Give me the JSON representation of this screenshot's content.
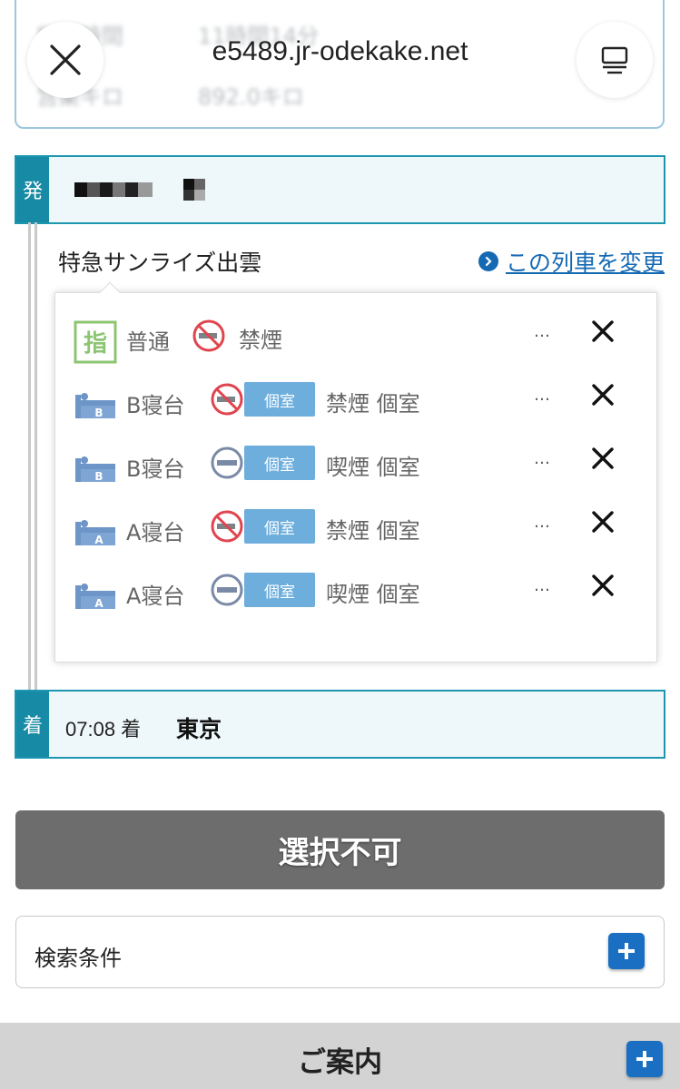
{
  "browser": {
    "url": "e5489.jr-odekake.net",
    "close_icon": "close-icon",
    "menu_icon": "tabs-icon"
  },
  "background_card": {
    "line1_label": "所要時間",
    "line1_value": "11時間14分",
    "line2_label": "営業キロ",
    "line2_value": "892.0キロ"
  },
  "departure": {
    "tag": "発"
  },
  "train": {
    "name": "特急サンライズ出雲",
    "change_link": "この列車を変更"
  },
  "seats": [
    {
      "icon": "reserved-seat-icon",
      "class": "普通",
      "smoking_icon": "no-smoking-icon",
      "private": "",
      "desc": "禁煙",
      "availability": "…",
      "status_icon": "unavailable-x-icon"
    },
    {
      "icon": "b-sleeper-icon",
      "class": "B寝台",
      "smoking_icon": "no-smoking-icon",
      "private": "個室",
      "desc": "禁煙 個室",
      "availability": "…",
      "status_icon": "unavailable-x-icon"
    },
    {
      "icon": "b-sleeper-icon",
      "class": "B寝台",
      "smoking_icon": "smoking-icon",
      "private": "個室",
      "desc": "喫煙 個室",
      "availability": "…",
      "status_icon": "unavailable-x-icon"
    },
    {
      "icon": "a-sleeper-icon",
      "class": "A寝台",
      "smoking_icon": "no-smoking-icon",
      "private": "個室",
      "desc": "禁煙 個室",
      "availability": "…",
      "status_icon": "unavailable-x-icon"
    },
    {
      "icon": "a-sleeper-icon",
      "class": "A寝台",
      "smoking_icon": "smoking-icon",
      "private": "個室",
      "desc": "喫煙 個室",
      "availability": "…",
      "status_icon": "unavailable-x-icon"
    }
  ],
  "arrival": {
    "tag": "着",
    "time": "07:08 着",
    "station": "東京"
  },
  "actions": {
    "select_button": "選択不可"
  },
  "search": {
    "label": "検索条件"
  },
  "guide": {
    "label": "ご案内"
  },
  "colors": {
    "accent": "#178aa5",
    "link": "#1569b3",
    "private_badge": "#6eaedc",
    "disabled_button": "#6d6d6d",
    "no_smoking_red": "#e0454f",
    "smoking_gray": "#7a8aa6"
  }
}
